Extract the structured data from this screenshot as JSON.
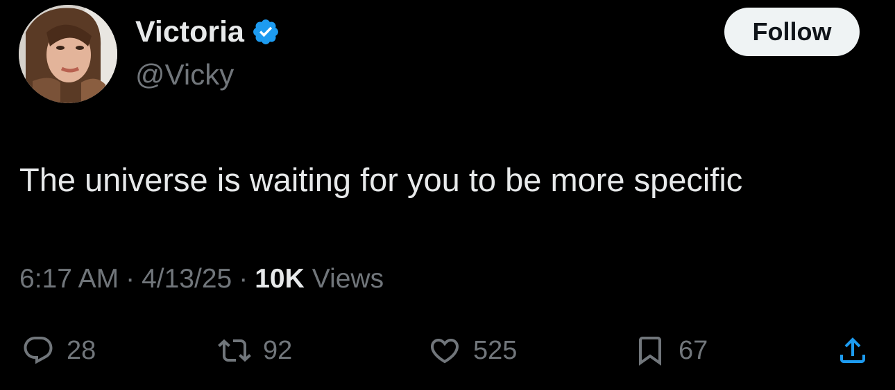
{
  "author": {
    "display_name": "Victoria",
    "handle": "@Vicky",
    "verified": true
  },
  "follow_label": "Follow",
  "tweet": {
    "text": "The universe is waiting for you to be more specific",
    "time": "6:17 AM",
    "date": "4/13/25",
    "views_count": "10K",
    "views_label": "Views"
  },
  "actions": {
    "replies": "28",
    "reposts": "92",
    "likes": "525",
    "bookmarks": "67"
  },
  "colors": {
    "background": "#000000",
    "primary_text": "#e7e9ea",
    "secondary_text": "#71767b",
    "verified_badge": "#1d9bf0",
    "follow_button": "#eff3f4"
  }
}
